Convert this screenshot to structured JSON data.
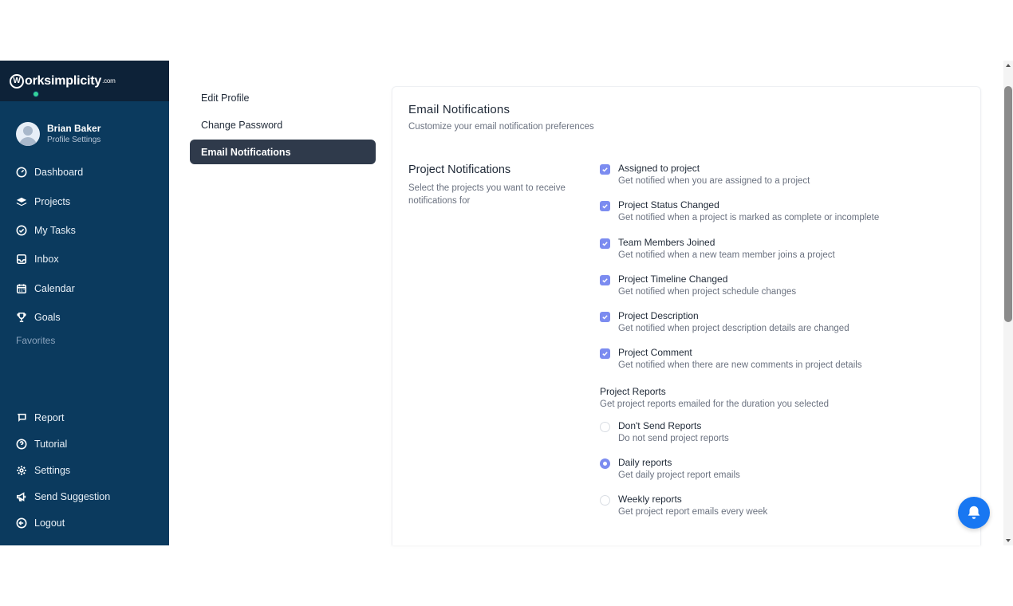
{
  "brand": {
    "logo_letter": "W",
    "logo_text": "orksimplicity",
    "logo_suffix": ".com"
  },
  "user": {
    "name": "Brian Baker",
    "subtitle": "Profile Settings"
  },
  "nav": {
    "items": [
      {
        "label": "Dashboard",
        "icon": "dashboard-icon"
      },
      {
        "label": "Projects",
        "icon": "layers-icon"
      },
      {
        "label": "My Tasks",
        "icon": "check-circle-icon"
      },
      {
        "label": "Inbox",
        "icon": "inbox-icon"
      },
      {
        "label": "Calendar",
        "icon": "calendar-icon"
      },
      {
        "label": "Goals",
        "icon": "trophy-icon"
      }
    ],
    "favorites_label": "Favorites",
    "bottom": [
      {
        "label": "Report",
        "icon": "flag-icon"
      },
      {
        "label": "Tutorial",
        "icon": "help-icon"
      },
      {
        "label": "Settings",
        "icon": "gear-icon"
      },
      {
        "label": "Send Suggestion",
        "icon": "megaphone-icon"
      },
      {
        "label": "Logout",
        "icon": "logout-icon"
      }
    ]
  },
  "settings_menu": {
    "items": [
      "Edit Profile",
      "Change Password",
      "Email Notifications"
    ],
    "active": "Email Notifications"
  },
  "main": {
    "title": "Email Notifications",
    "subtitle": "Customize your email notification preferences",
    "section_title": "Project Notifications",
    "section_desc": "Select the projects you want to receive notifications for",
    "options": [
      {
        "title": "Assigned to project",
        "desc": "Get notified when you are assigned to a project",
        "checked": true
      },
      {
        "title": "Project Status Changed",
        "desc": "Get notified when a project is marked as complete or incomplete",
        "checked": true
      },
      {
        "title": "Team Members Joined",
        "desc": "Get notified when a new team member joins a project",
        "checked": true
      },
      {
        "title": "Project Timeline Changed",
        "desc": "Get notified when project schedule changes",
        "checked": true
      },
      {
        "title": "Project Description",
        "desc": "Get notified when project description details are changed",
        "checked": true
      },
      {
        "title": "Project Comment",
        "desc": "Get notified when there are new comments in project details",
        "checked": true
      }
    ],
    "reports_title": "Project Reports",
    "reports_desc": "Get project reports emailed for the duration you selected",
    "report_options": [
      {
        "title": "Don't Send Reports",
        "desc": "Do not send project reports",
        "selected": false
      },
      {
        "title": "Daily reports",
        "desc": "Get daily project report emails",
        "selected": true
      },
      {
        "title": "Weekly reports",
        "desc": "Get project report emails every week",
        "selected": false
      }
    ]
  },
  "colors": {
    "sidebar": "#0b3a5e",
    "logo_bar": "#0d2238",
    "accent": "#7c8cf0",
    "bell": "#1877f2",
    "active_menu": "#2f3a4b"
  }
}
